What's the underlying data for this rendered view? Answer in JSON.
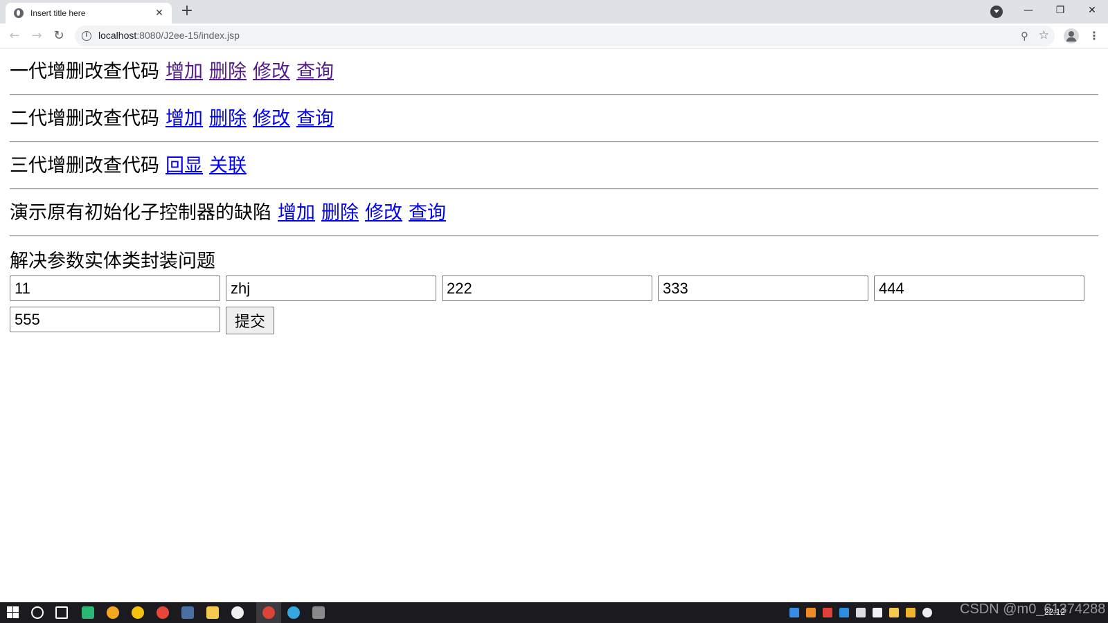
{
  "browser": {
    "tab_title": "Insert title here",
    "tab_close": "✕",
    "new_tab": "+",
    "url_host": "localhost",
    "url_path": ":8080/J2ee-15/index.jsp",
    "window_controls": {
      "minimize": "—",
      "maximize": "❐",
      "close": "✕"
    },
    "icons": [
      "globe-icon",
      "back-icon",
      "forward-icon",
      "reload-icon",
      "info-icon",
      "zoom-icon",
      "star-icon",
      "profile-icon",
      "menu-icon",
      "tab-search-icon"
    ]
  },
  "sections": [
    {
      "label": "一代增删改查代码",
      "links": [
        "增加",
        "删除",
        "修改",
        "查询"
      ],
      "visited": true
    },
    {
      "label": "二代增删改查代码",
      "links": [
        "增加",
        "删除",
        "修改",
        "查询"
      ],
      "visited": false
    },
    {
      "label": "三代增删改查代码",
      "links": [
        "回显",
        "关联"
      ],
      "visited": false
    },
    {
      "label": "演示原有初始化子控制器的缺陷",
      "links": [
        "增加",
        "删除",
        "修改",
        "查询"
      ],
      "visited": false
    }
  ],
  "form": {
    "title": "解决参数实体类封装问题",
    "fields": [
      "11",
      "zhj",
      "222",
      "333",
      "444",
      "555"
    ],
    "submit_label": "提交"
  },
  "colors": {
    "link": "#0000ee",
    "visited_link": "#551a8b",
    "tabstrip": "#dee1e6",
    "taskbar": "#1b1b1f"
  },
  "taskbar": {
    "clock": "22:12",
    "watermark": "CSDN @m0_61374288",
    "icons": [
      "windows-start-icon",
      "search-icon",
      "task-view-icon",
      "game-app-icon",
      "browser-g-icon",
      "chrome-colored-icon",
      "qq-icon",
      "file-explorer-icon",
      "folder-icon",
      "media-icon",
      "chrome-icon",
      "edge-icon",
      "settings-icon"
    ]
  }
}
